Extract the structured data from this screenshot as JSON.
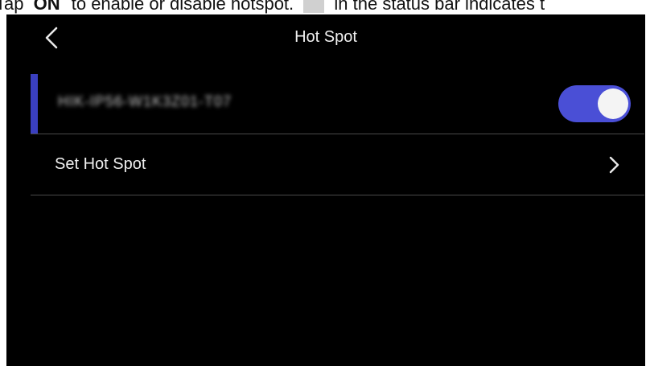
{
  "caption": {
    "prefix": "Tap",
    "toggle_label": "ON",
    "middle": "to enable or disable hotspot.",
    "suffix": "in the status bar indicates t"
  },
  "header": {
    "back_icon": "chevron-left-icon",
    "title": "Hot Spot"
  },
  "hotspot": {
    "name": "HIK-IP56-W1K3Z01-T07",
    "enabled": true,
    "accent_color": "#3a3fbf",
    "toggle_color": "#4a4fd6"
  },
  "menu": {
    "set_hotspot_label": "Set Hot Spot",
    "chevron_icon": "chevron-right-icon"
  },
  "colors": {
    "background": "#000000",
    "text": "#f0f0f0",
    "divider": "#4a4a4a"
  }
}
